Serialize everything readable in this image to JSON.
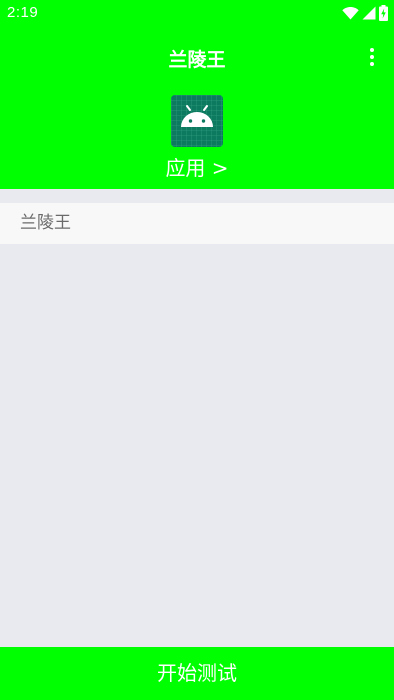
{
  "status_bar": {
    "time": "2:19",
    "icons": [
      "wifi-icon",
      "signal-icon",
      "battery-charging-icon"
    ]
  },
  "header": {
    "title": "兰陵王",
    "menu_icon": "more-vert-icon",
    "app_icon": "android-icon",
    "app_link_label": "应用 >"
  },
  "list": {
    "items": [
      {
        "label": "兰陵王"
      }
    ]
  },
  "footer": {
    "button_label": "开始测试"
  },
  "colors": {
    "accent": "#00ff00",
    "background": "#e8eaef",
    "icon_bg": "#0b7a5e",
    "list_item_bg": "#f8f8f9",
    "list_item_text": "#6a6a6a"
  }
}
